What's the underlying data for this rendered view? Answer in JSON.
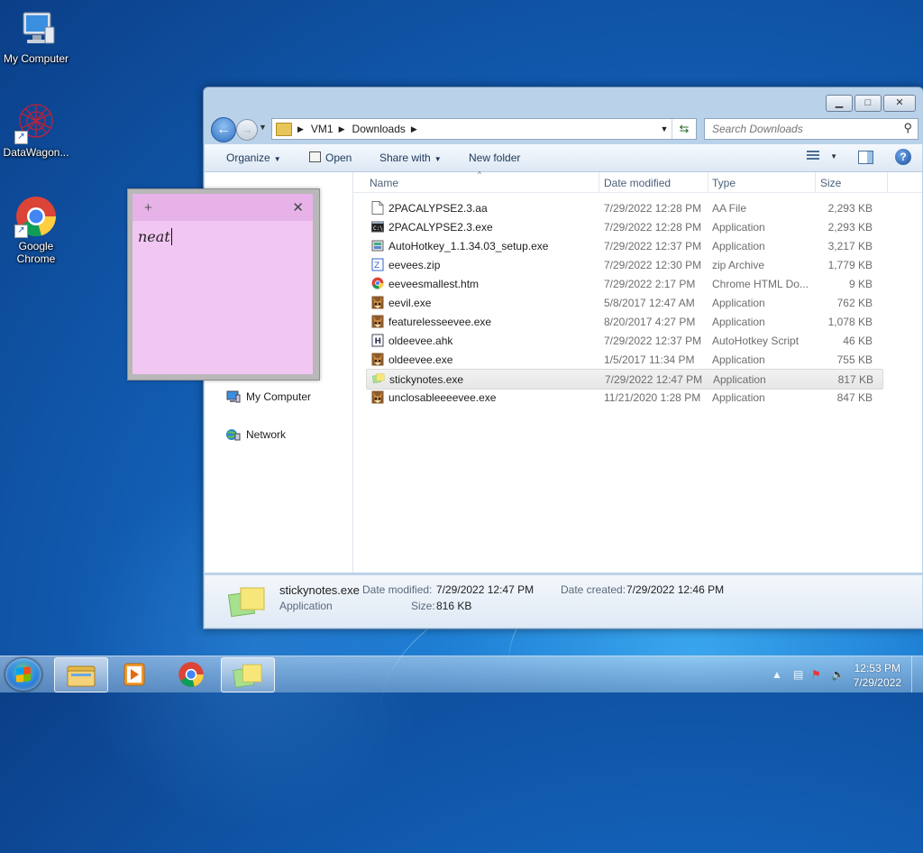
{
  "desktop": {
    "icons": [
      {
        "label": "My Computer"
      },
      {
        "label": "DataWagon..."
      },
      {
        "label": "Google Chrome"
      }
    ]
  },
  "explorer": {
    "breadcrumb": [
      "VM1",
      "Downloads"
    ],
    "search_placeholder": "Search Downloads",
    "toolbar": {
      "organize": "Organize",
      "open": "Open",
      "share_with": "Share with",
      "new_folder": "New folder"
    },
    "columns": {
      "name": "Name",
      "date": "Date modified",
      "type": "Type",
      "size": "Size"
    },
    "nav_items": [
      "My Computer",
      "Network"
    ],
    "files": [
      {
        "name": "2PACALYPSE2.3.aa",
        "date": "7/29/2022 12:28 PM",
        "type": "AA File",
        "size": "2,293 KB",
        "icon": "blank-file-icon"
      },
      {
        "name": "2PACALYPSE2.3.exe",
        "date": "7/29/2022 12:28 PM",
        "type": "Application",
        "size": "2,293 KB",
        "icon": "console-app-icon"
      },
      {
        "name": "AutoHotkey_1.1.34.03_setup.exe",
        "date": "7/29/2022 12:37 PM",
        "type": "Application",
        "size": "3,217 KB",
        "icon": "installer-icon"
      },
      {
        "name": "eevees.zip",
        "date": "7/29/2022 12:30 PM",
        "type": "zip Archive",
        "size": "1,779 KB",
        "icon": "zip-icon"
      },
      {
        "name": "eeveesmallest.htm",
        "date": "7/29/2022 2:17 PM",
        "type": "Chrome HTML Do...",
        "size": "9 KB",
        "icon": "chrome-doc-icon"
      },
      {
        "name": "eevil.exe",
        "date": "5/8/2017 12:47 AM",
        "type": "Application",
        "size": "762 KB",
        "icon": "eevee-app-icon"
      },
      {
        "name": "featureless​eevee.exe",
        "date": "8/20/2017 4:27 PM",
        "type": "Application",
        "size": "1,078 KB",
        "icon": "eevee-app-icon"
      },
      {
        "name": "oldeevee.ahk",
        "date": "7/29/2022 12:37 PM",
        "type": "AutoHotkey Script",
        "size": "46 KB",
        "icon": "ahk-script-icon"
      },
      {
        "name": "oldeevee.exe",
        "date": "1/5/2017 11:34 PM",
        "type": "Application",
        "size": "755 KB",
        "icon": "eevee-app-icon"
      },
      {
        "name": "stickynotes.exe",
        "date": "7/29/2022 12:47 PM",
        "type": "Application",
        "size": "817 KB",
        "icon": "sticky-notes-icon"
      },
      {
        "name": "unclosableeeevee.exe",
        "date": "11/21/2020 1:28 PM",
        "type": "Application",
        "size": "847 KB",
        "icon": "eevee-app-icon"
      }
    ],
    "details": {
      "filename": "stickynotes.exe",
      "type": "Application",
      "date_modified_label": "Date modified:",
      "date_modified": "7/29/2022 12:47 PM",
      "date_created_label": "Date created:",
      "date_created": "7/29/2022 12:46 PM",
      "size_label": "Size:",
      "size": "816 KB"
    }
  },
  "sticky": {
    "plus": "+",
    "close": "✕",
    "text": "neat"
  },
  "taskbar": {
    "time": "12:53 PM",
    "date": "7/29/2022"
  },
  "colors": {
    "sticky_head": "#e6b2e8",
    "sticky_body": "#f2c6f2",
    "accent": "#1f7fd3"
  }
}
